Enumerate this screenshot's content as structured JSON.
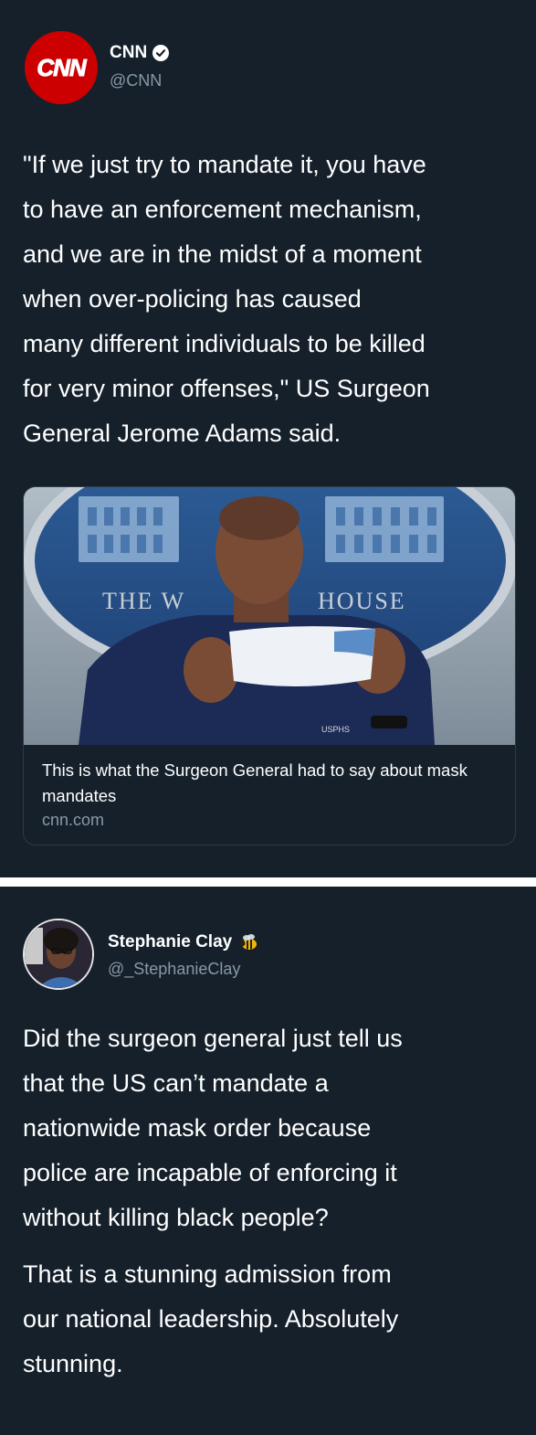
{
  "cnn_tweet": {
    "avatar_text": "CNN",
    "display_name": "CNN",
    "handle": "@CNN",
    "text": "\"If we just try to mandate it, you have\nto have an enforcement mechanism,\nand we are in the midst of a moment\nwhen over-policing has caused\nmany different individuals to be killed\nfor very minor offenses,\" US Surgeon\nGeneral Jerome Adams said.",
    "card": {
      "image_sign_left": "THE W",
      "image_sign_right": "HOUSE",
      "badge_text": "USPHS",
      "title": "This is what the Surgeon General had to say about mask mandates",
      "domain": "cnn.com"
    }
  },
  "reply_tweet": {
    "display_name": "Stephanie Clay",
    "handle": "@_StephanieClay",
    "paragraph1": "Did the surgeon general just tell us\nthat the US can’t mandate a\nnationwide mask order because\npolice are incapable of enforcing it\nwithout killing black people?",
    "paragraph2": "That is a stunning admission from\nour national leadership. Absolutely\nstunning."
  },
  "colors": {
    "background": "#15202b",
    "secondary_text": "#8899a6",
    "cnn_red": "#cc0000",
    "separator": "#ffffff"
  },
  "icons": [
    "verified-badge-icon",
    "bee-emoji-icon"
  ]
}
